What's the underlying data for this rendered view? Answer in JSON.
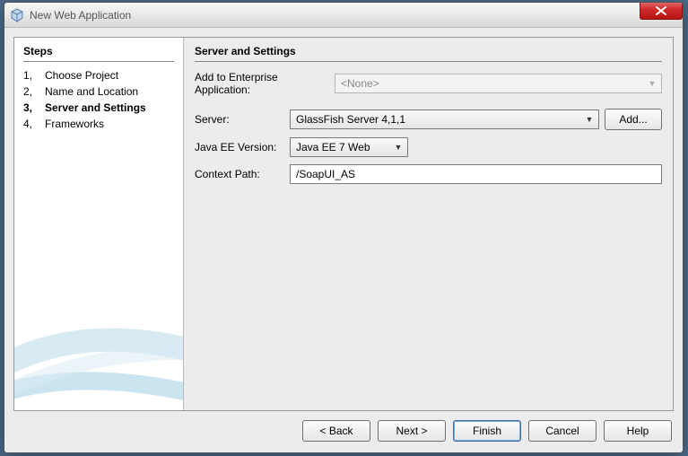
{
  "window": {
    "title": "New Web Application"
  },
  "sidebar": {
    "title": "Steps",
    "current_index": 2,
    "items": [
      {
        "num": "1,",
        "label": "Choose Project"
      },
      {
        "num": "2,",
        "label": "Name and Location"
      },
      {
        "num": "3,",
        "label": "Server and Settings"
      },
      {
        "num": "4,",
        "label": "Frameworks"
      }
    ]
  },
  "page": {
    "title": "Server and Settings",
    "enterprise_label": "Add to Enterprise Application:",
    "enterprise_value": "<None>",
    "server_label": "Server:",
    "server_value": "GlassFish Server 4,1,1",
    "add_button": "Add...",
    "javaee_label": "Java EE Version:",
    "javaee_value": "Java EE 7 Web",
    "context_label": "Context Path:",
    "context_value": "/SoapUI_AS"
  },
  "buttons": {
    "back": "< Back",
    "next": "Next >",
    "finish": "Finish",
    "cancel": "Cancel",
    "help": "Help"
  }
}
